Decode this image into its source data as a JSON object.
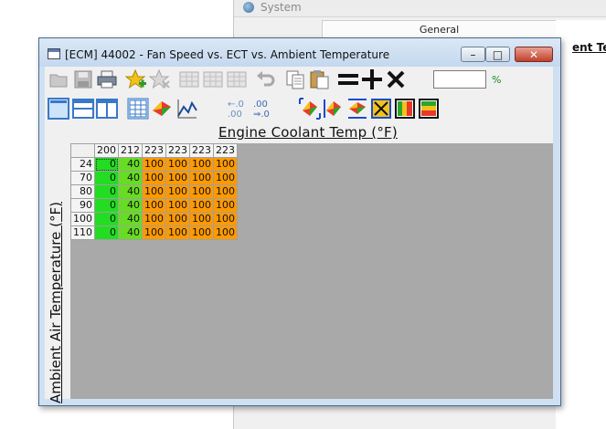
{
  "background_window": {
    "title": "System",
    "tab_label": "General",
    "clipped_text": "ent Tem"
  },
  "window": {
    "title": "[ECM] 44002 - Fan Speed vs. ECT vs. Ambient Temperature",
    "minimize": "–",
    "maximize": "□",
    "close": "✕"
  },
  "toolbar": {
    "percent_value": "",
    "percent_label": "%",
    "icons_row1": [
      "open-icon",
      "save-icon",
      "print-icon",
      "add-favorite-icon",
      "remove-favorite-icon",
      "table-grid-icon-a",
      "table-grid-icon-b",
      "table-grid-icon-c",
      "undo-icon",
      "copy-icon",
      "paste-icon",
      "set-equal-icon",
      "add-icon",
      "multiply-icon"
    ],
    "icons_row2": [
      "view-single-icon",
      "view-split-horizontal-icon",
      "view-split-vertical-icon",
      "table-view-icon",
      "3d-view-icon",
      "graph-view-icon",
      "decrease-decimal-icon",
      "increase-decimal-icon",
      "interpolate-horizontal-icon",
      "interpolate-vertical-icon",
      "smooth-icon",
      "select-fill-icon",
      "fill-horizontal-icon",
      "fill-vertical-icon"
    ]
  },
  "table": {
    "x_axis_label": "Engine Coolant Temp (°F)",
    "y_axis_label": "Ambient Air Temperature (°F)",
    "columns": [
      "200",
      "212",
      "223",
      "223",
      "223",
      "223"
    ],
    "rows": [
      {
        "label": "24",
        "values": [
          "0",
          "40",
          "100",
          "100",
          "100",
          "100"
        ]
      },
      {
        "label": "70",
        "values": [
          "0",
          "40",
          "100",
          "100",
          "100",
          "100"
        ]
      },
      {
        "label": "80",
        "values": [
          "0",
          "40",
          "100",
          "100",
          "100",
          "100"
        ]
      },
      {
        "label": "90",
        "values": [
          "0",
          "40",
          "100",
          "100",
          "100",
          "100"
        ]
      },
      {
        "label": "100",
        "values": [
          "0",
          "40",
          "100",
          "100",
          "100",
          "100"
        ]
      },
      {
        "label": "110",
        "values": [
          "0",
          "40",
          "100",
          "100",
          "100",
          "100"
        ]
      }
    ],
    "colors": {
      "0": "#22dd22",
      "40": "#66dd22",
      "100": "#ff9900"
    }
  }
}
